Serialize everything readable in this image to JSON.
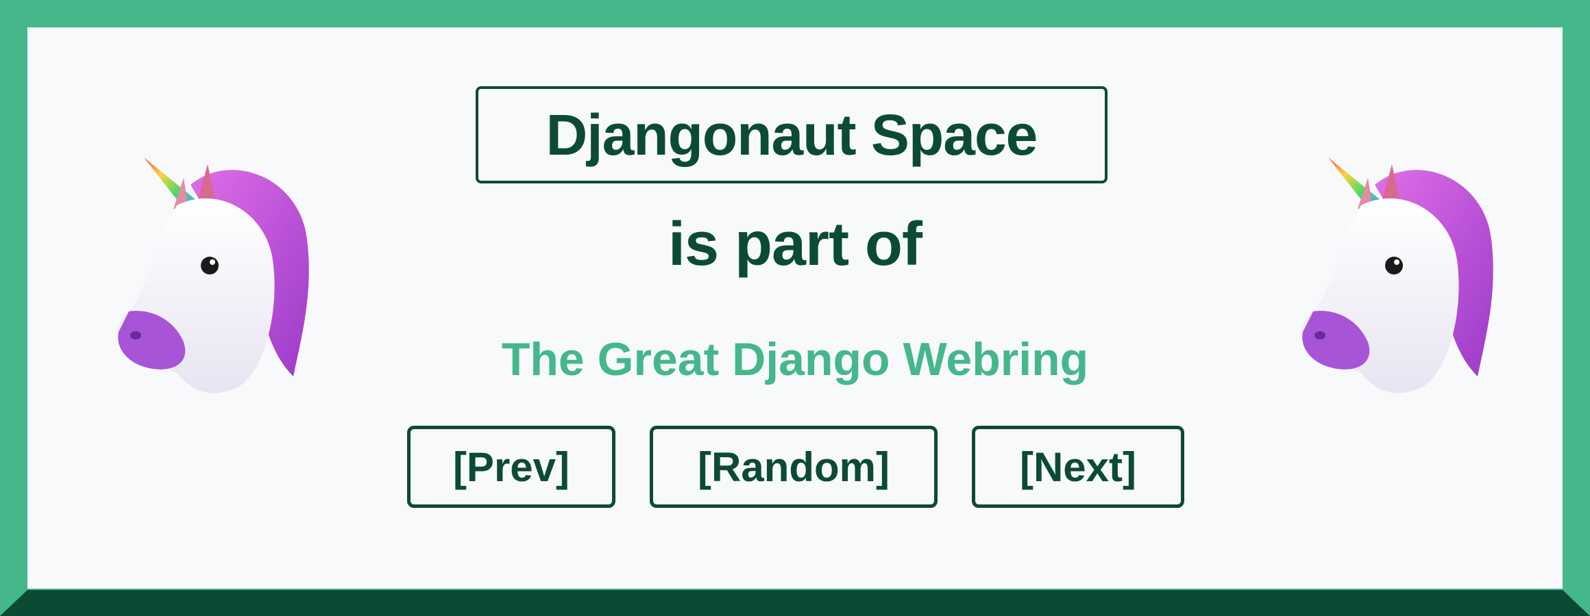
{
  "site": {
    "name": "Djangonaut Space"
  },
  "connector": "is part of",
  "webring": {
    "name": "The Great Django Webring"
  },
  "nav": {
    "prev_label": "[Prev]",
    "random_label": "[Random]",
    "next_label": "[Next]"
  },
  "decorations": {
    "left_icon": "unicorn-icon",
    "right_icon": "unicorn-icon"
  },
  "colors": {
    "dark_green": "#0c4b33",
    "light_green": "#44b78b",
    "background": "#f8f9fb"
  }
}
